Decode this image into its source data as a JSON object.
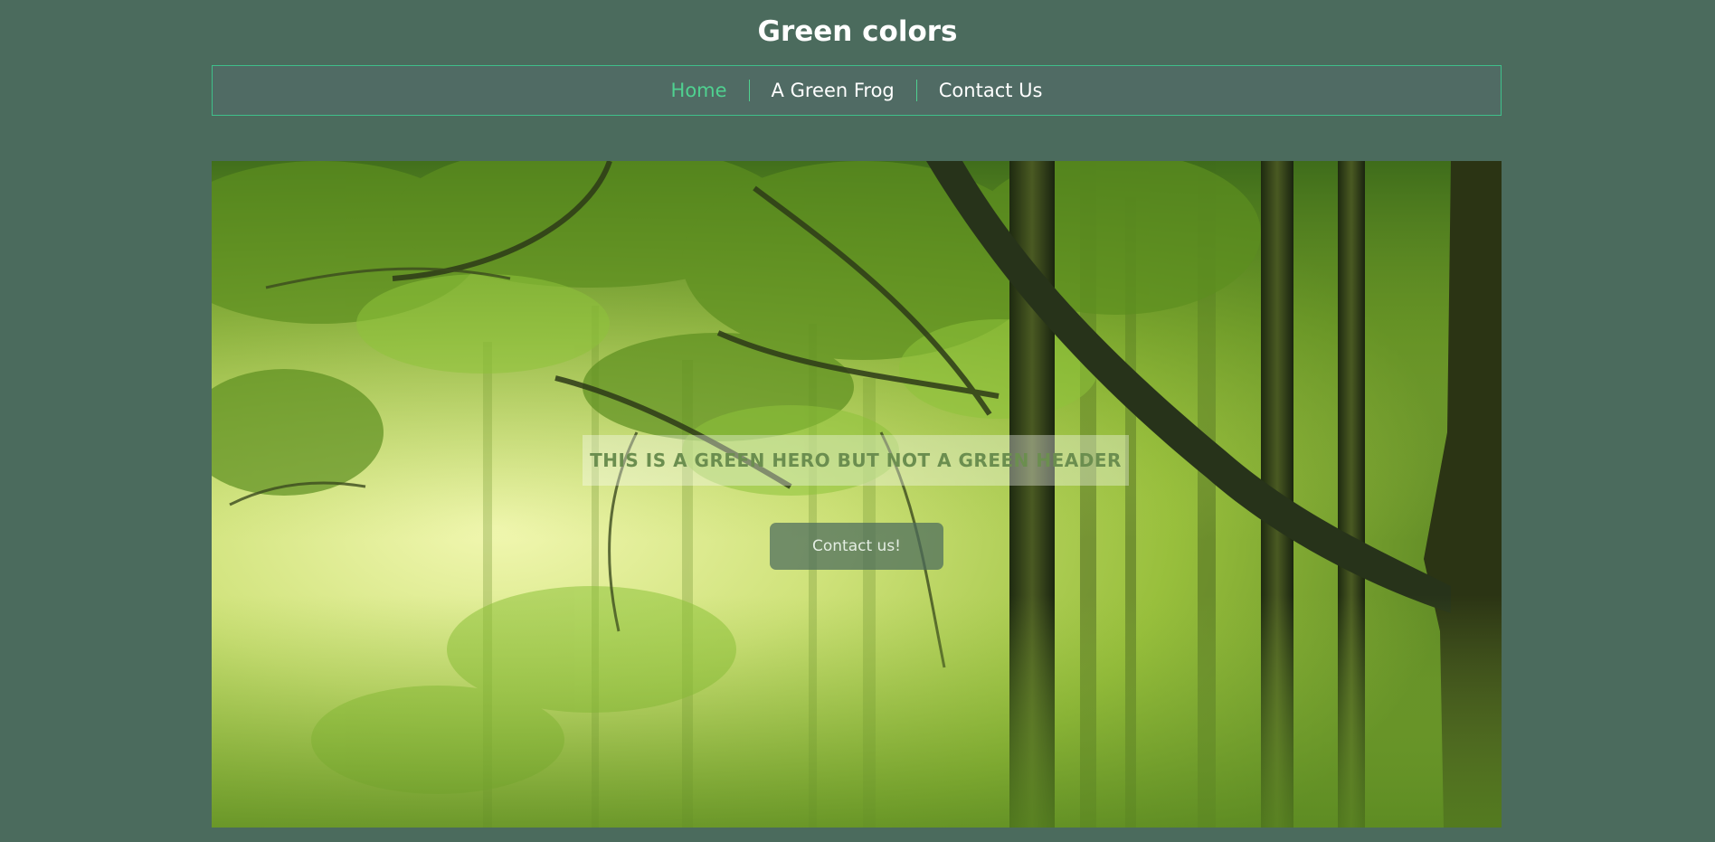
{
  "site": {
    "title": "Green colors"
  },
  "nav": {
    "items": [
      {
        "label": "Home",
        "active": true
      },
      {
        "label": "A Green Frog",
        "active": false
      },
      {
        "label": "Contact Us",
        "active": false
      }
    ]
  },
  "hero": {
    "heading": "THIS IS A GREEN HERO BUT NOT A GREEN HEADER",
    "button_label": "Contact us!",
    "image": "forest-photo"
  },
  "colors": {
    "page_background": "#4b6b5d",
    "nav_background": "#506b64",
    "nav_accent": "#4fd190",
    "title_text": "#ffffff",
    "hero_heading_text": "#6b8e4f"
  }
}
